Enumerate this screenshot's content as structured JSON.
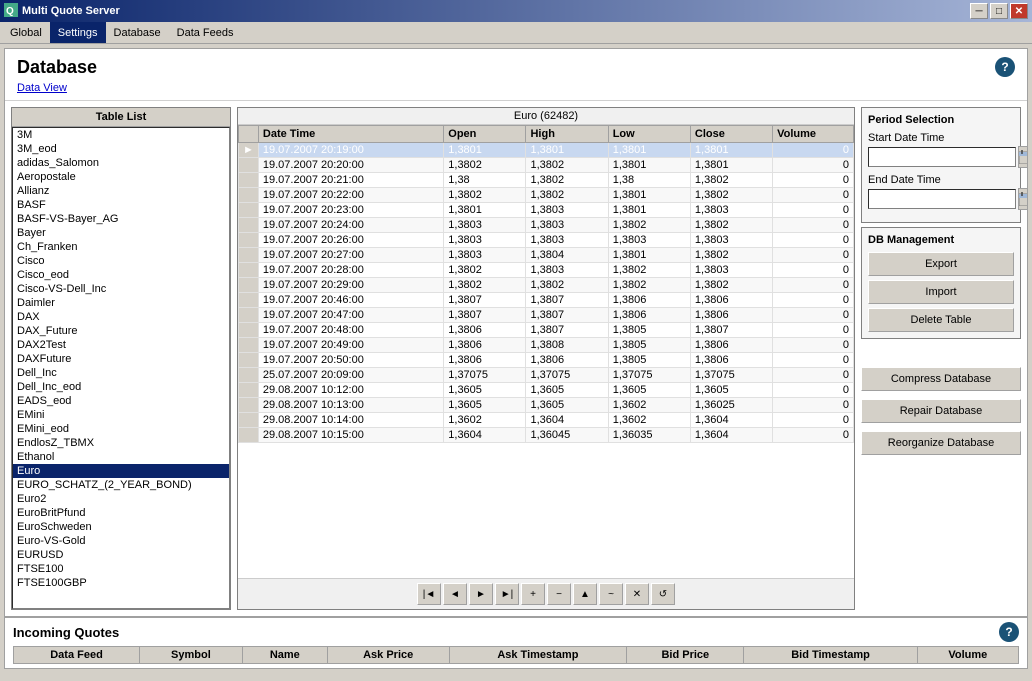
{
  "titleBar": {
    "title": "Multi Quote Server",
    "minBtn": "─",
    "maxBtn": "□",
    "closeBtn": "✕"
  },
  "menuBar": {
    "items": [
      {
        "label": "Global",
        "active": false
      },
      {
        "label": "Settings",
        "active": true
      },
      {
        "label": "Database",
        "active": false
      },
      {
        "label": "Data Feeds",
        "active": false
      }
    ]
  },
  "pageTitle": "Database",
  "dataViewLink": "Data View",
  "tableList": {
    "header": "Table List",
    "items": [
      "3M",
      "3M_eod",
      "adidas_Salomon",
      "Aeropostale",
      "Allianz",
      "BASF",
      "BASF-VS-Bayer_AG",
      "Bayer",
      "Ch_Franken",
      "Cisco",
      "Cisco_eod",
      "Cisco-VS-Dell_Inc",
      "Daimler",
      "DAX",
      "DAX_Future",
      "DAX2Test",
      "DAXFuture",
      "Dell_Inc",
      "Dell_Inc_eod",
      "EADS_eod",
      "EMini",
      "EMini_eod",
      "EndlosZ_TBMX",
      "Ethanol",
      "Euro",
      "EURO_SCHATZ_(2_YEAR_BOND)",
      "Euro2",
      "EuroBritPfund",
      "EuroSchweden",
      "Euro-VS-Gold",
      "EURUSD",
      "FTSE100",
      "FTSE100GBP"
    ],
    "selectedIndex": 24
  },
  "gridTitle": "Euro (62482)",
  "gridColumns": [
    "Date Time",
    "Open",
    "High",
    "Low",
    "Close",
    "Volume"
  ],
  "gridRows": [
    {
      "selected": true,
      "datetime": "19.07.2007 20:19:00",
      "open": "1,3801",
      "high": "1,3801",
      "low": "1,3801",
      "close": "1,3801",
      "volume": "0"
    },
    {
      "selected": false,
      "datetime": "19.07.2007 20:20:00",
      "open": "1,3802",
      "high": "1,3802",
      "low": "1,3801",
      "close": "1,3801",
      "volume": "0"
    },
    {
      "selected": false,
      "datetime": "19.07.2007 20:21:00",
      "open": "1,38",
      "high": "1,3802",
      "low": "1,38",
      "close": "1,3802",
      "volume": "0"
    },
    {
      "selected": false,
      "datetime": "19.07.2007 20:22:00",
      "open": "1,3802",
      "high": "1,3802",
      "low": "1,3801",
      "close": "1,3802",
      "volume": "0"
    },
    {
      "selected": false,
      "datetime": "19.07.2007 20:23:00",
      "open": "1,3801",
      "high": "1,3803",
      "low": "1,3801",
      "close": "1,3803",
      "volume": "0"
    },
    {
      "selected": false,
      "datetime": "19.07.2007 20:24:00",
      "open": "1,3803",
      "high": "1,3803",
      "low": "1,3802",
      "close": "1,3802",
      "volume": "0"
    },
    {
      "selected": false,
      "datetime": "19.07.2007 20:26:00",
      "open": "1,3803",
      "high": "1,3803",
      "low": "1,3803",
      "close": "1,3803",
      "volume": "0"
    },
    {
      "selected": false,
      "datetime": "19.07.2007 20:27:00",
      "open": "1,3803",
      "high": "1,3804",
      "low": "1,3801",
      "close": "1,3802",
      "volume": "0"
    },
    {
      "selected": false,
      "datetime": "19.07.2007 20:28:00",
      "open": "1,3802",
      "high": "1,3803",
      "low": "1,3802",
      "close": "1,3803",
      "volume": "0"
    },
    {
      "selected": false,
      "datetime": "19.07.2007 20:29:00",
      "open": "1,3802",
      "high": "1,3802",
      "low": "1,3802",
      "close": "1,3802",
      "volume": "0"
    },
    {
      "selected": false,
      "datetime": "19.07.2007 20:46:00",
      "open": "1,3807",
      "high": "1,3807",
      "low": "1,3806",
      "close": "1,3806",
      "volume": "0"
    },
    {
      "selected": false,
      "datetime": "19.07.2007 20:47:00",
      "open": "1,3807",
      "high": "1,3807",
      "low": "1,3806",
      "close": "1,3806",
      "volume": "0"
    },
    {
      "selected": false,
      "datetime": "19.07.2007 20:48:00",
      "open": "1,3806",
      "high": "1,3807",
      "low": "1,3805",
      "close": "1,3807",
      "volume": "0"
    },
    {
      "selected": false,
      "datetime": "19.07.2007 20:49:00",
      "open": "1,3806",
      "high": "1,3808",
      "low": "1,3805",
      "close": "1,3806",
      "volume": "0"
    },
    {
      "selected": false,
      "datetime": "19.07.2007 20:50:00",
      "open": "1,3806",
      "high": "1,3806",
      "low": "1,3805",
      "close": "1,3806",
      "volume": "0"
    },
    {
      "selected": false,
      "datetime": "25.07.2007 20:09:00",
      "open": "1,37075",
      "high": "1,37075",
      "low": "1,37075",
      "close": "1,37075",
      "volume": "0"
    },
    {
      "selected": false,
      "datetime": "29.08.2007 10:12:00",
      "open": "1,3605",
      "high": "1,3605",
      "low": "1,3605",
      "close": "1,3605",
      "volume": "0"
    },
    {
      "selected": false,
      "datetime": "29.08.2007 10:13:00",
      "open": "1,3605",
      "high": "1,3605",
      "low": "1,3602",
      "close": "1,36025",
      "volume": "0"
    },
    {
      "selected": false,
      "datetime": "29.08.2007 10:14:00",
      "open": "1,3602",
      "high": "1,3604",
      "low": "1,3602",
      "close": "1,3604",
      "volume": "0"
    },
    {
      "selected": false,
      "datetime": "29.08.2007 10:15:00",
      "open": "1,3604",
      "high": "1,36045",
      "low": "1,36035",
      "close": "1,3604",
      "volume": "0"
    }
  ],
  "toolbarBtns": [
    "|◄",
    "◄",
    "►",
    "►|",
    "+",
    "−",
    "▲",
    "~",
    "✕",
    "↺"
  ],
  "periodSelection": {
    "title": "Period Selection",
    "startLabel": "Start Date Time",
    "endLabel": "End Date Time",
    "startValue": "",
    "endValue": ""
  },
  "dbManagement": {
    "title": "DB Management",
    "exportLabel": "Export",
    "importLabel": "Import",
    "deleteLabel": "Delete Table",
    "compressLabel": "Compress Database",
    "repairLabel": "Repair Database",
    "reorganizeLabel": "Reorganize Database"
  },
  "incomingQuotes": {
    "title": "Incoming Quotes",
    "columns": [
      "Data Feed",
      "Symbol",
      "Name",
      "Ask Price",
      "Ask Timestamp",
      "Bid Price",
      "Bid Timestamp",
      "Volume"
    ]
  }
}
